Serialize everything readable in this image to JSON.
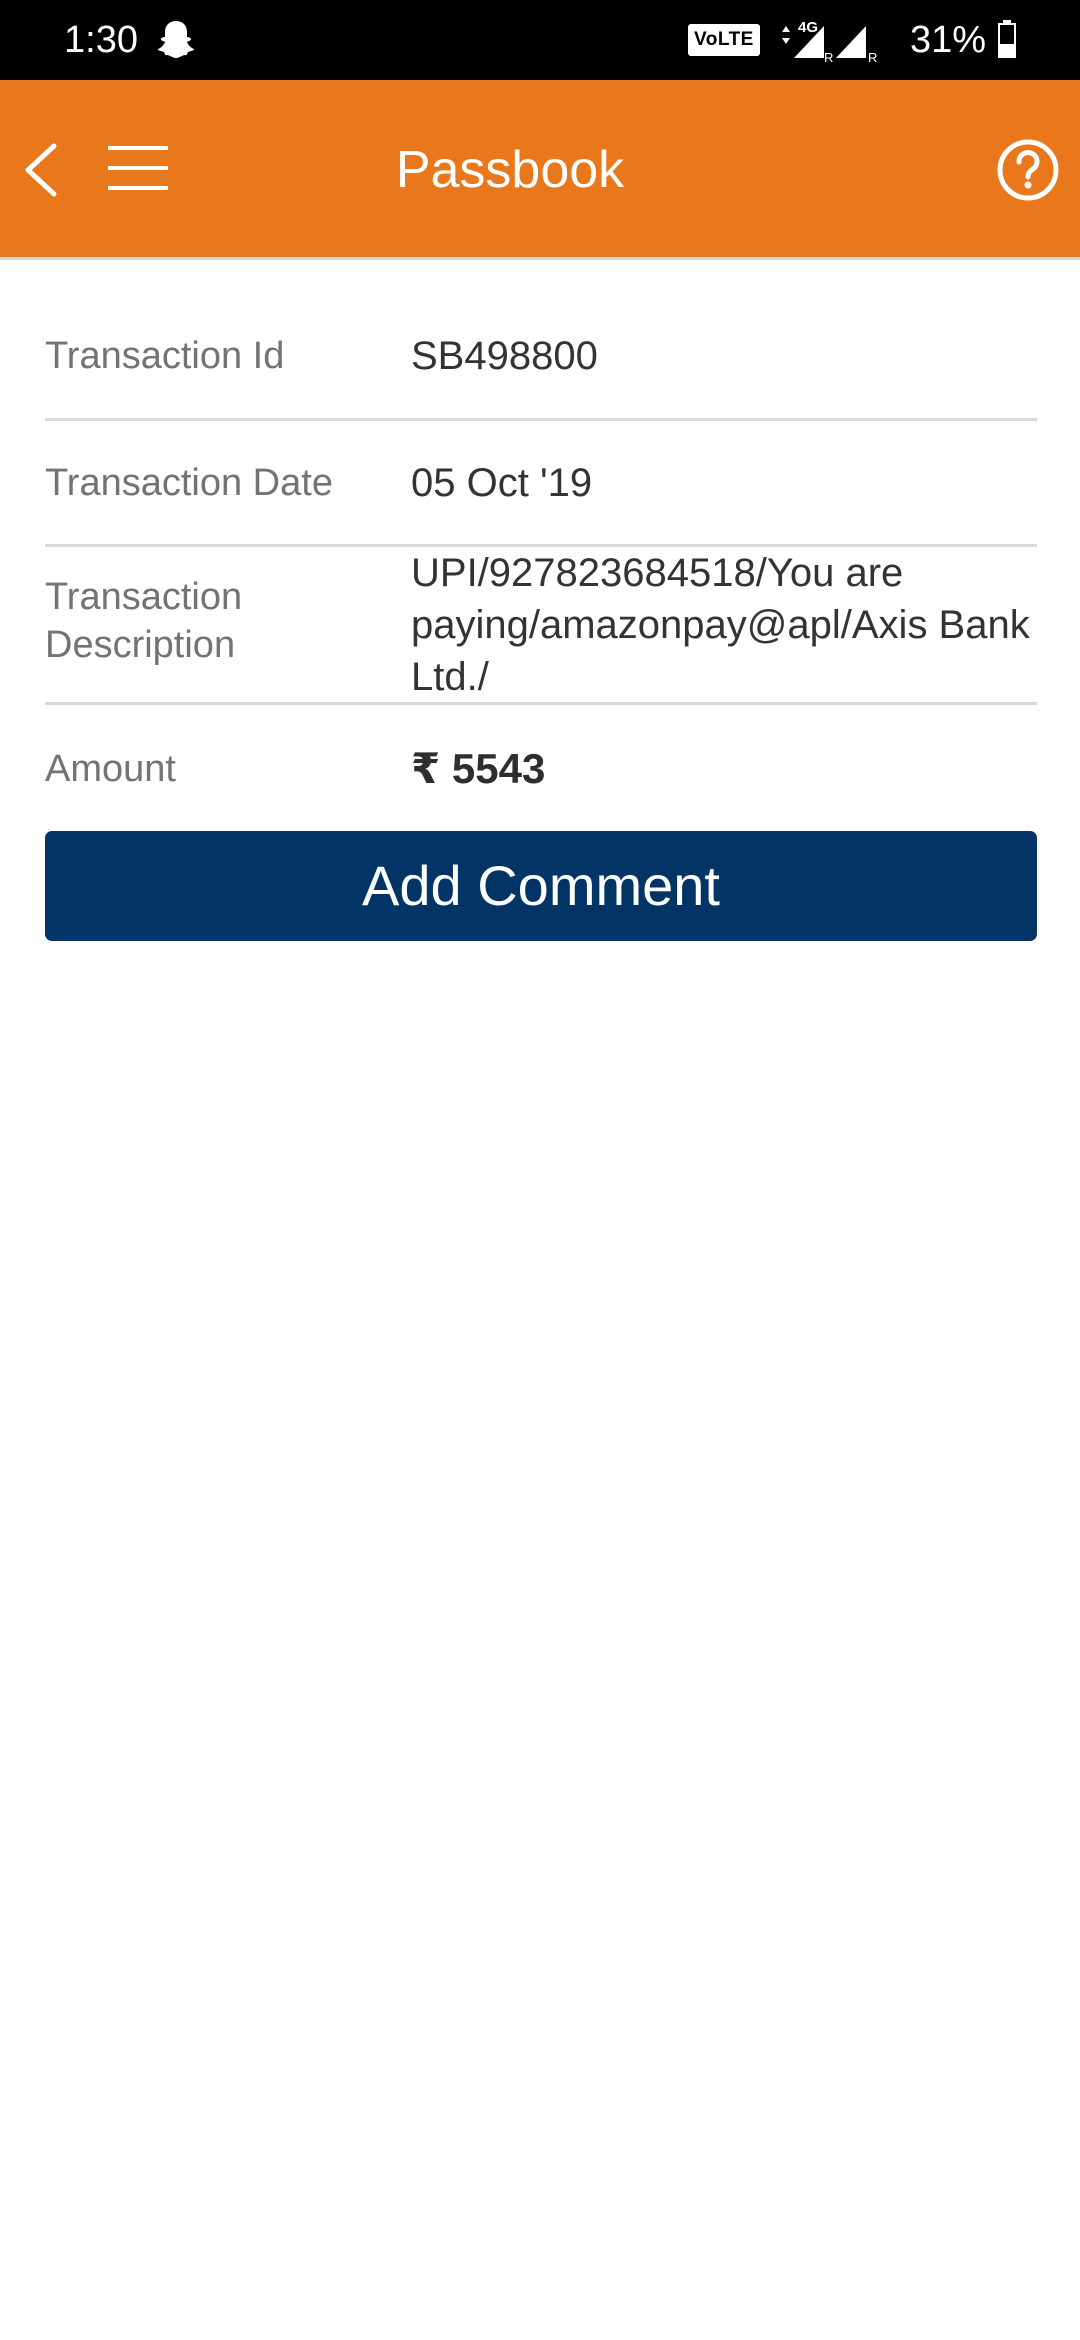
{
  "status_bar": {
    "time": "1:30",
    "network_badge": "VoLTE",
    "battery_percent": "31%",
    "icons": [
      "snapchat-icon",
      "signal-icon",
      "battery-icon"
    ]
  },
  "header": {
    "title": "Passbook",
    "icons": [
      "back-icon",
      "hamburger-menu-icon",
      "help-icon"
    ],
    "background_color": "#e8781b"
  },
  "details": {
    "rows": [
      {
        "label": "Transaction Id",
        "value": "SB498800"
      },
      {
        "label": "Transaction Date",
        "value": "05 Oct '19"
      },
      {
        "label": "Transaction Description",
        "value": "UPI/927823684518/You are paying/amazonpay@apl/Axis Bank Ltd./"
      },
      {
        "label": "Amount",
        "value": "₹ 5543"
      }
    ]
  },
  "actions": {
    "add_comment_label": "Add Comment",
    "button_color": "#023465"
  }
}
